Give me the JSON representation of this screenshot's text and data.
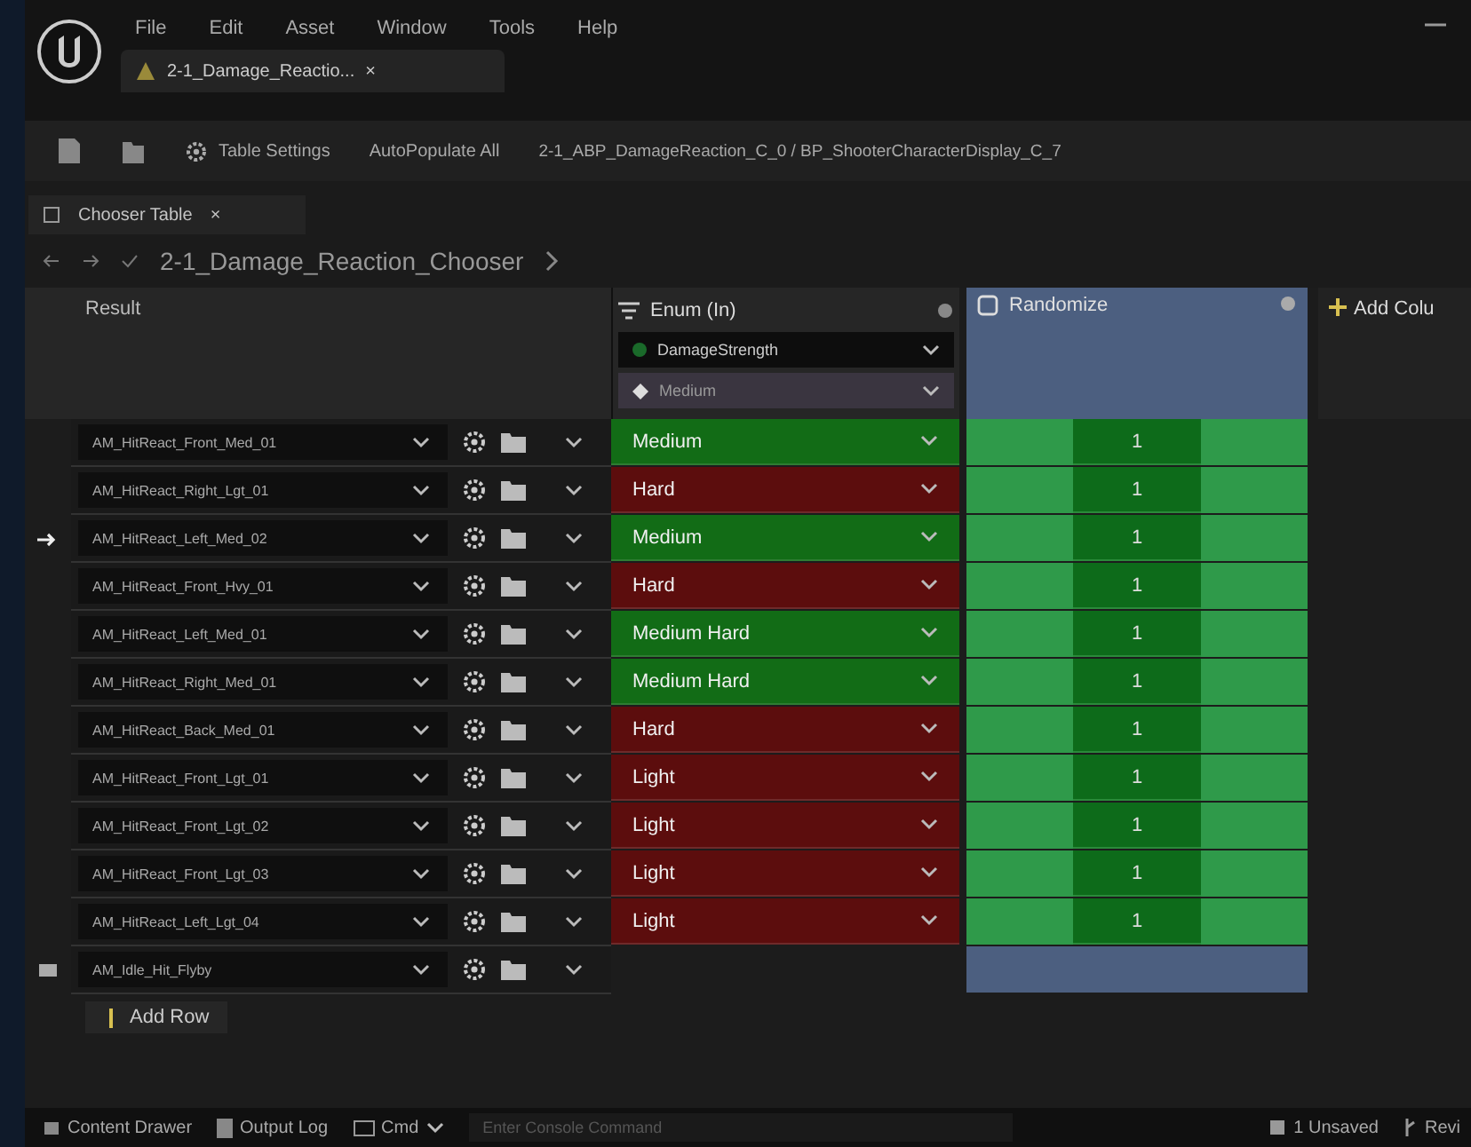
{
  "menu": [
    "File",
    "Edit",
    "Asset",
    "Window",
    "Tools",
    "Help"
  ],
  "document_tab": {
    "label": "2-1_Damage_Reactio...",
    "close": "×"
  },
  "toolbar": {
    "settings": "Table Settings",
    "autopopulate": "AutoPopulate All",
    "debug_target": "2-1_ABP_DamageReaction_C_0 / BP_ShooterCharacterDisplay_C_7"
  },
  "panel_tab": {
    "label": "Chooser Table",
    "close": "×"
  },
  "breadcrumb": {
    "path": "2-1_Damage_Reaction_Chooser"
  },
  "table": {
    "result_header": "Result",
    "columns": [
      {
        "kind": "enum",
        "title": "Enum (In)",
        "binding": "DamageStrength",
        "test_value": "Medium"
      },
      {
        "kind": "random",
        "title": "Randomize"
      }
    ],
    "add_column": "Add Colu",
    "rows": [
      {
        "kind": "entry",
        "selected": false,
        "result": "AM_HitReact_Front_Med_01",
        "enum": "Medium",
        "color": "#126c16",
        "random": "1"
      },
      {
        "kind": "entry",
        "selected": false,
        "result": "AM_HitReact_Right_Lgt_01",
        "enum": "Hard",
        "color": "#5c0d0d",
        "random": "1"
      },
      {
        "kind": "entry",
        "selected": true,
        "result": "AM_HitReact_Left_Med_02",
        "enum": "Medium",
        "color": "#126c16",
        "random": "1"
      },
      {
        "kind": "entry",
        "selected": false,
        "result": "AM_HitReact_Front_Hvy_01",
        "enum": "Hard",
        "color": "#5c0d0d",
        "random": "1"
      },
      {
        "kind": "entry",
        "selected": false,
        "result": "AM_HitReact_Left_Med_01",
        "enum": "Medium Hard",
        "color": "#126c16",
        "random": "1"
      },
      {
        "kind": "entry",
        "selected": false,
        "result": "AM_HitReact_Right_Med_01",
        "enum": "Medium Hard",
        "color": "#126c16",
        "random": "1"
      },
      {
        "kind": "entry",
        "selected": false,
        "result": "AM_HitReact_Back_Med_01",
        "enum": "Hard",
        "color": "#5c0d0d",
        "random": "1"
      },
      {
        "kind": "entry",
        "selected": false,
        "result": "AM_HitReact_Front_Lgt_01",
        "enum": "Light",
        "color": "#5c0d0d",
        "random": "1"
      },
      {
        "kind": "entry",
        "selected": false,
        "result": "AM_HitReact_Front_Lgt_02",
        "enum": "Light",
        "color": "#5c0d0d",
        "random": "1"
      },
      {
        "kind": "entry",
        "selected": false,
        "result": "AM_HitReact_Front_Lgt_03",
        "enum": "Light",
        "color": "#5c0d0d",
        "random": "1"
      },
      {
        "kind": "entry",
        "selected": false,
        "result": "AM_HitReact_Left_Lgt_04",
        "enum": "Light",
        "color": "#5c0d0d",
        "random": "1"
      },
      {
        "kind": "fallback",
        "selected": false,
        "result": "AM_Idle_Hit_Flyby"
      }
    ],
    "add_row": "Add Row"
  },
  "status_bar": {
    "content_drawer": "Content Drawer",
    "output_log": "Output Log",
    "cmd": "Cmd",
    "console_placeholder": "Enter Console Command",
    "unsaved": "1 Unsaved",
    "revision": "Revi"
  }
}
